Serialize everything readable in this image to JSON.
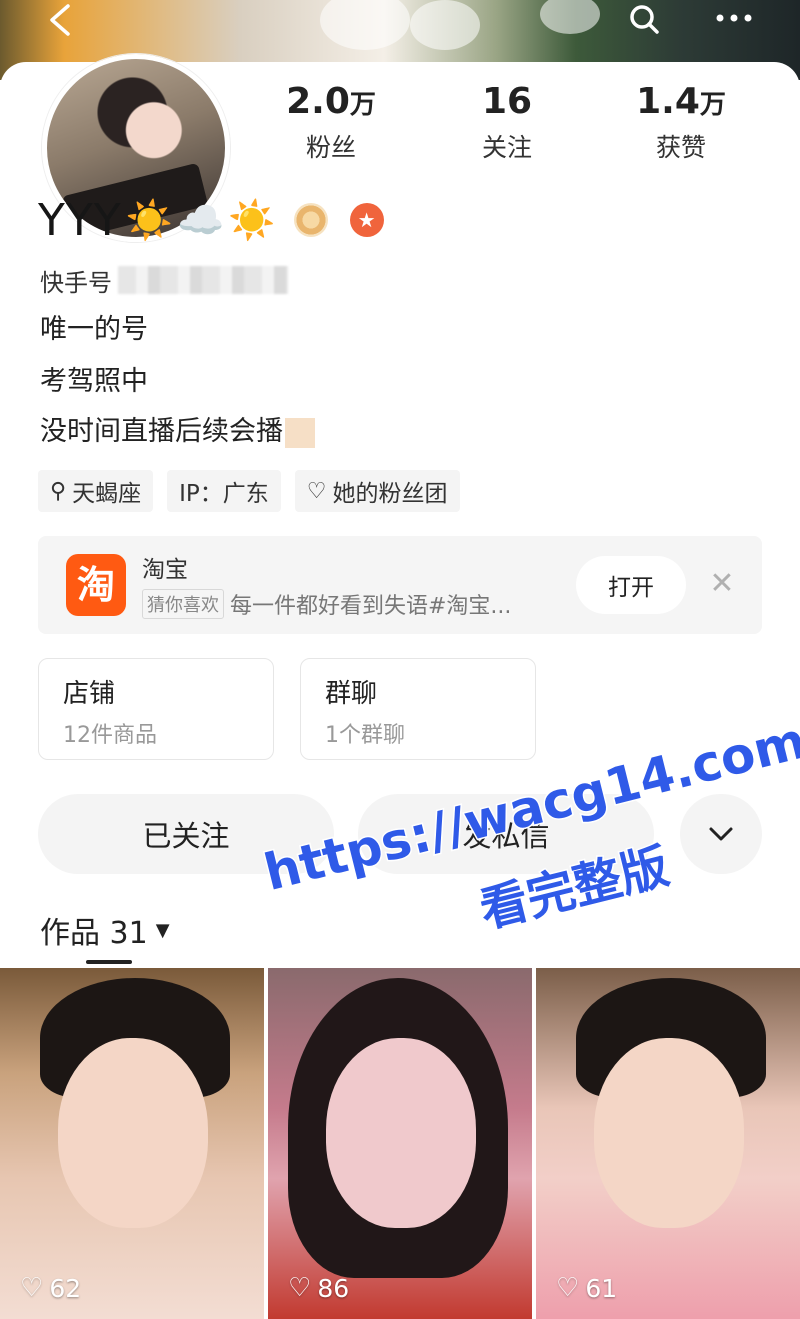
{
  "profile": {
    "name": "YYY",
    "name_emojis": [
      "☀️",
      "☁️",
      "☀️"
    ],
    "kuaishou_id_label": "快手号",
    "bio_lines": [
      "唯一的号",
      "考驾照中",
      "没时间直播后续会播"
    ],
    "stats": [
      {
        "number": "2.0",
        "unit": "万",
        "label": "粉丝"
      },
      {
        "number": "16",
        "unit": "",
        "label": "关注"
      },
      {
        "number": "1.4",
        "unit": "万",
        "label": "获赞"
      }
    ],
    "tags": [
      {
        "icon": "search-icon",
        "label": "天蝎座"
      },
      {
        "icon": "",
        "label": "IP：广东"
      },
      {
        "icon": "heart-outline-icon",
        "label": "她的粉丝团"
      }
    ]
  },
  "taobao_ad": {
    "logo_text": "淘",
    "title": "淘宝",
    "chip": "猜你喜欢",
    "text": "每一件都好看到失语#淘宝...",
    "open_label": "打开",
    "close_label": "✕"
  },
  "info_cards": [
    {
      "title": "店铺",
      "subtitle": "12件商品"
    },
    {
      "title": "群聊",
      "subtitle": "1个群聊"
    }
  ],
  "actions": {
    "followed_label": "已关注",
    "message_label": "发私信",
    "more_icon": "chevron-down-icon"
  },
  "works": {
    "tab_label": "作品 31",
    "items": [
      {
        "likes": "62"
      },
      {
        "likes": "86"
      },
      {
        "likes": "61"
      }
    ]
  },
  "watermark": {
    "url": "https://wacg14.com",
    "text": "看完整版"
  },
  "colors": {
    "accent_orange": "#ff5a12",
    "watermark_blue": "#2f5ae8",
    "badge_star": "#f0643c"
  }
}
